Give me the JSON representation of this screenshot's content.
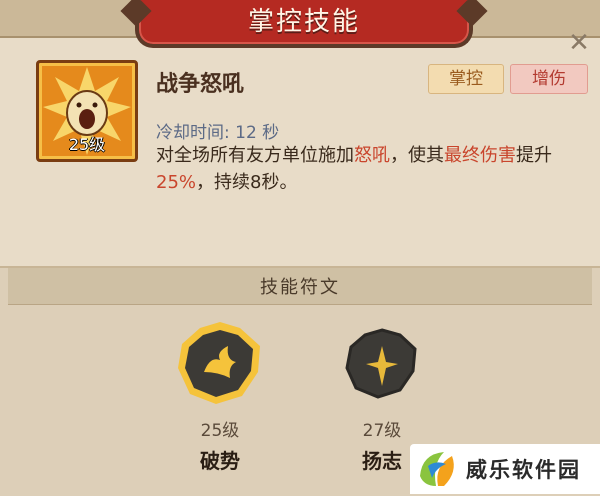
{
  "header": {
    "title": "掌控技能"
  },
  "skill": {
    "name": "战争怒吼",
    "level": "25级",
    "tags": {
      "control": "掌控",
      "damage": "增伤"
    },
    "cooldown": "冷却时间: 12 秒",
    "desc_parts": {
      "p1": "对全场所有友方单位施加",
      "p2": "怒吼",
      "p3": "，使其",
      "p4": "最终伤害",
      "p5": "提升",
      "p6": "25%",
      "p7": "，持续8秒。"
    }
  },
  "runes": {
    "title": "技能符文",
    "items": [
      {
        "level": "25级",
        "name": "破势"
      },
      {
        "level": "27级",
        "name": "扬志"
      }
    ]
  },
  "watermark": {
    "text": "威乐软件园"
  },
  "colors": {
    "banner": "#b52a22",
    "highlight": "#c9452c",
    "rune_active": "#f5c33b"
  }
}
